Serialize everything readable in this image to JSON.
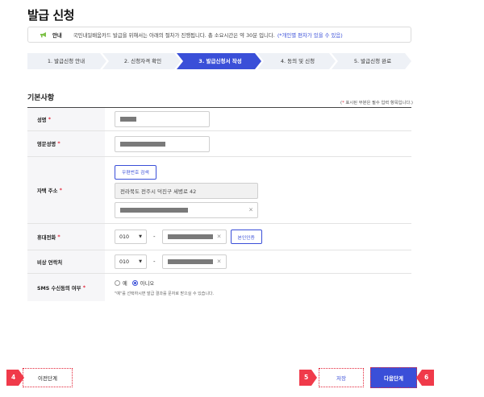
{
  "page": {
    "title": "발급 신청"
  },
  "notice": {
    "icon": "megaphone-icon",
    "label": "안내",
    "message": "국민내일배움카드 발급을 위해서는 아래의 절차가 진행됩니다. 총 소요시간은 약 30분 입니다.",
    "highlight": "(*개인별 편차가 있을 수 있음)"
  },
  "steps": {
    "items": [
      {
        "label": "1. 발급신청 안내"
      },
      {
        "label": "2. 신청자격 확인"
      },
      {
        "label": "3. 발급신청서 작성"
      },
      {
        "label": "4. 동의 및 신청"
      },
      {
        "label": "5. 발급신청 완료"
      }
    ],
    "active_index": 2
  },
  "section": {
    "title": "기본사항"
  },
  "required_note": {
    "open": "(",
    "star": "*",
    "text": " 표시된 부분은 필수 입력 항목입니다.)"
  },
  "form": {
    "name": {
      "label": "성명",
      "required": "*"
    },
    "english_name": {
      "label": "영문성명",
      "required": "*"
    },
    "address": {
      "label": "자택 주소",
      "required": "*",
      "search_button": "우편번호 검색",
      "address1": "전라북도 전주시 덕진구 세병로 42"
    },
    "mobile": {
      "label": "휴대전화",
      "required": "*",
      "prefix": "010",
      "dash": "-",
      "verify_button": "본인인증"
    },
    "emergency": {
      "label": "비상 연락처",
      "prefix": "010",
      "dash": "-"
    },
    "sms": {
      "label": "SMS 수신동의 여부",
      "required": "*",
      "option_yes": "예",
      "option_no": "아니오",
      "selected": "아니오",
      "hint": "\"예\"를 선택하시면 발급 결과를 문자로 받으실 수 있습니다."
    }
  },
  "footer": {
    "prev_button": "이전단계",
    "save_button": "저장",
    "next_button": "다음단계"
  },
  "markers": {
    "prev": "4",
    "save": "5",
    "next": "6"
  },
  "colors": {
    "accent": "#3a4fd8",
    "required": "#e3263a",
    "marker": "#f03a4a",
    "step_inactive": "#eef1f6",
    "step_active": "#3a4fd8"
  }
}
